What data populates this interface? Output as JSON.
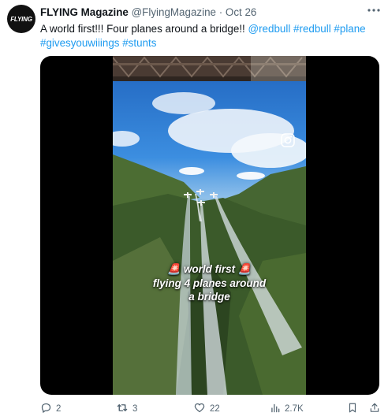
{
  "avatar": {
    "text": "FLYING"
  },
  "header": {
    "name": "FLYING Magazine",
    "handle": "@FlyingMagazine",
    "separator": "·",
    "date": "Oct 26"
  },
  "tweet": {
    "text": "A world first!!! Four planes around a bridge!!",
    "mention_1": "@redbull",
    "hashtags": [
      "#redbull",
      "#plane",
      "#givesyouwiiings",
      "#stunts"
    ]
  },
  "media": {
    "overlay_lines": [
      "🚨 world first 🚨",
      "flying 4 planes around",
      "a bridge"
    ],
    "watermark_icon": "instagram-icon"
  },
  "actions": {
    "reply_count": "2",
    "retweet_count": "3",
    "like_count": "22",
    "views_count": "2.7K"
  },
  "colors": {
    "text": "#0f1419",
    "secondary": "#536471",
    "link": "#1d9bf0"
  }
}
